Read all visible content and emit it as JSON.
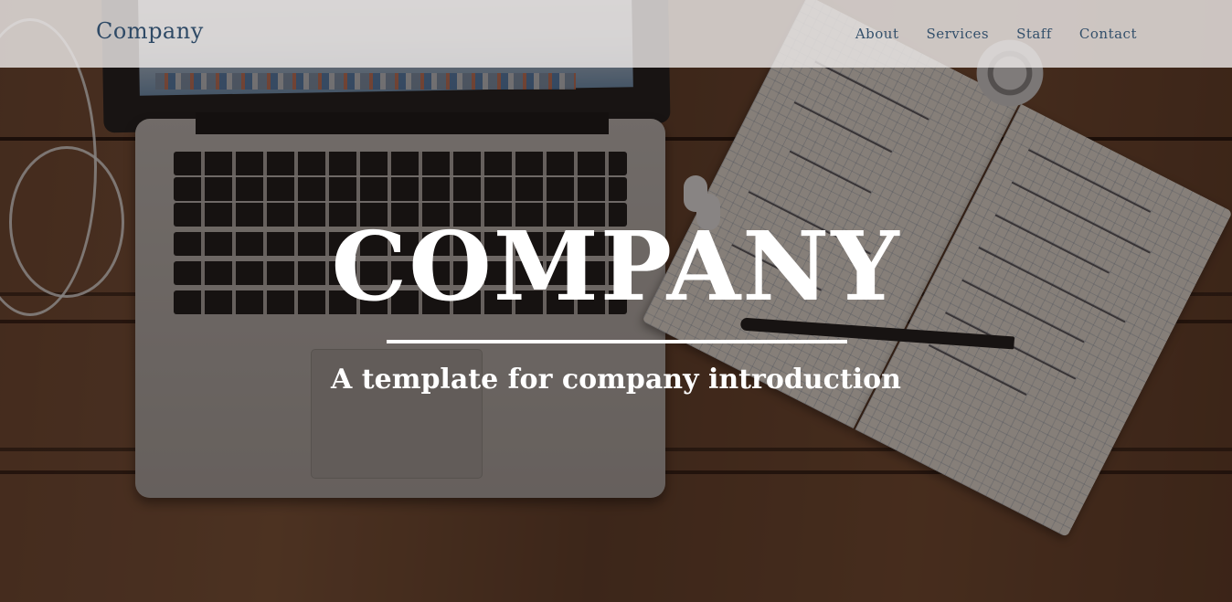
{
  "brand": {
    "name": "Company"
  },
  "nav": {
    "items": [
      {
        "label": "About"
      },
      {
        "label": "Services"
      },
      {
        "label": "Staff"
      },
      {
        "label": "Contact"
      }
    ]
  },
  "hero": {
    "title": "COMPANY",
    "subtitle": "A template for company introduction"
  },
  "colors": {
    "navbar_bg": "#ece8e6",
    "nav_text": "#34506b",
    "hero_text": "#ffffff"
  }
}
